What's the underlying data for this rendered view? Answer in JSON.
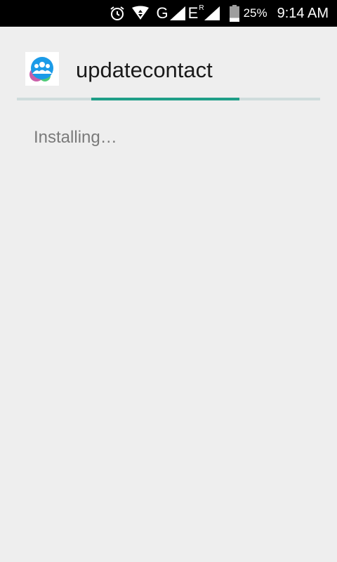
{
  "status_bar": {
    "network": "G",
    "network2": "E",
    "network2_sup": "R",
    "battery_percent": "25%",
    "battery_level": 0.25,
    "time": "9:14 AM",
    "icons": [
      "alarm-icon",
      "data-transfer-icon",
      "signal-icon",
      "signal-roaming-icon",
      "battery-icon"
    ]
  },
  "installer": {
    "app_name": "updatecontact",
    "status": "Installing…",
    "progress": "indeterminate"
  },
  "colors": {
    "status_bar_bg": "#000000",
    "background": "#eeeeee",
    "progress_track": "#cfdcdc",
    "progress_fill": "#1f9e87",
    "app_icon_blue": "#1b9be8"
  }
}
